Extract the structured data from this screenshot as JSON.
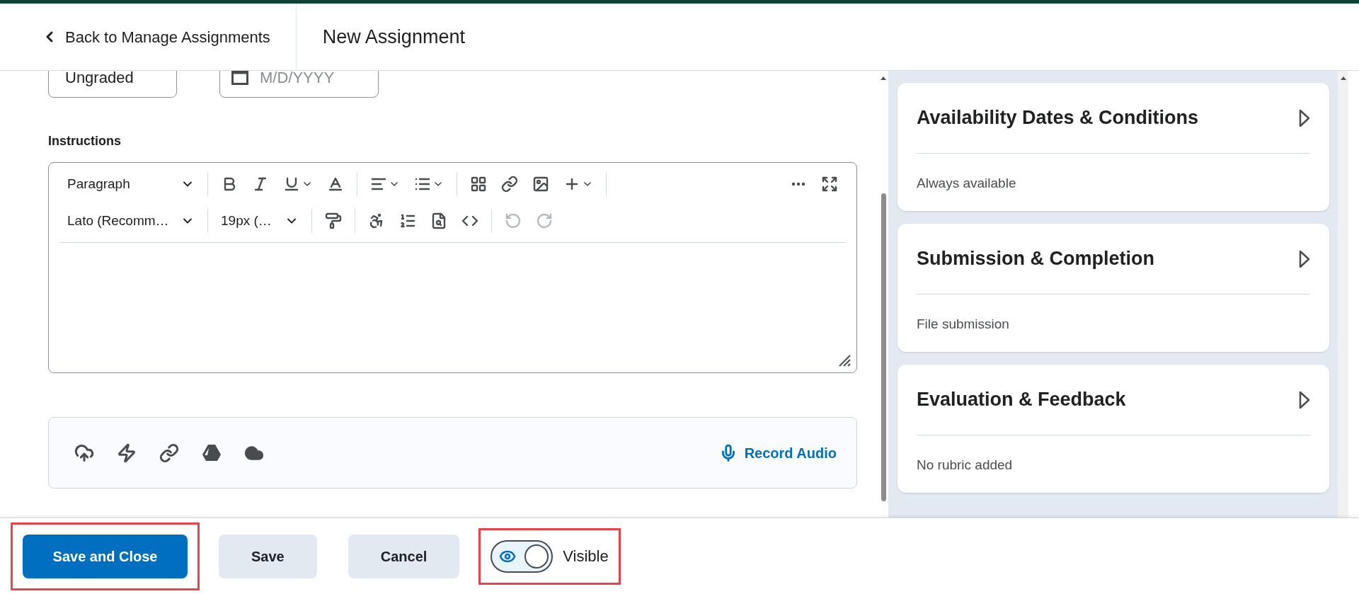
{
  "header": {
    "back_link": "Back to Manage Assignments",
    "title": "New Assignment"
  },
  "top_fields": {
    "grade_value": "Ungraded",
    "date_placeholder": "M/D/YYYY"
  },
  "instructions": {
    "label": "Instructions",
    "block_format": "Paragraph",
    "font_family": "Lato (Recomm…",
    "font_size": "19px (…",
    "undo": {
      "disabled": true
    },
    "redo": {
      "disabled": true
    }
  },
  "attachments": {
    "record_audio": "Record Audio"
  },
  "cards": [
    {
      "title": "Availability Dates & Conditions",
      "summary": "Always available"
    },
    {
      "title": "Submission & Completion",
      "summary": "File submission"
    },
    {
      "title": "Evaluation & Feedback",
      "summary": "No rubric added"
    }
  ],
  "footer": {
    "buttons": [
      {
        "label": "Save and Close",
        "kind": "primary",
        "highlighted": true
      },
      {
        "label": "Save",
        "kind": "secondary",
        "highlighted": false
      },
      {
        "label": "Cancel",
        "kind": "secondary",
        "highlighted": false
      }
    ],
    "visibility": {
      "label": "Visible",
      "on": true,
      "highlighted": true
    }
  }
}
